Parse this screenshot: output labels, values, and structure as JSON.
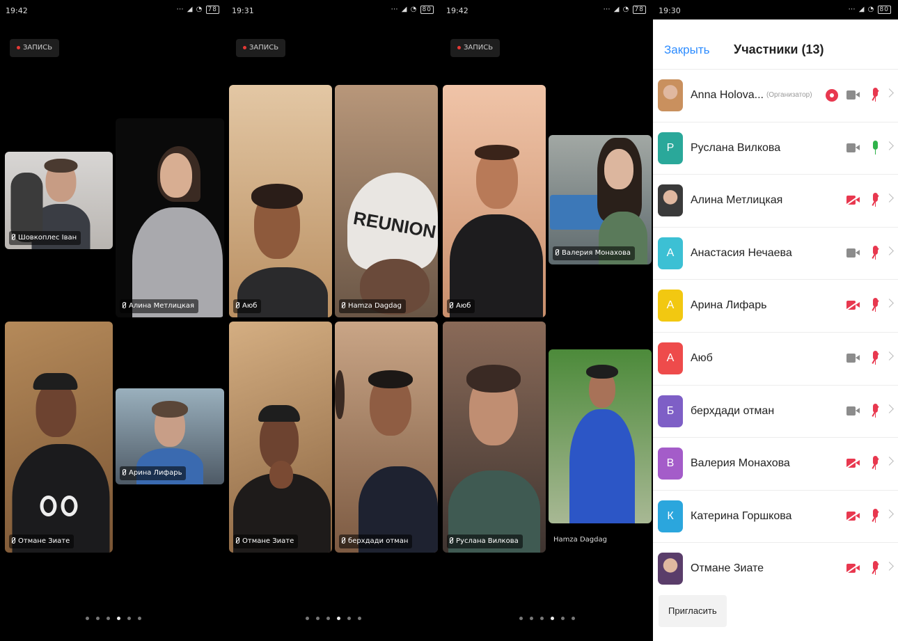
{
  "screens": [
    {
      "time": "19:42",
      "battery": "78",
      "record_label": "ЗАПИСЬ",
      "tiles": [
        {
          "name": "Шовкоплес Іван"
        },
        {
          "name": "Алина Метлицкая"
        },
        {
          "name": "Отмане Зиате"
        },
        {
          "name": "Арина Лифарь"
        }
      ],
      "page_count": 6,
      "active_page": 4
    },
    {
      "time": "19:31",
      "battery": "80",
      "record_label": "ЗАПИСЬ",
      "tiles": [
        {
          "name": "Аюб"
        },
        {
          "name": "Hamza Dagdag",
          "hat_text": "REUNION"
        },
        {
          "name": "Отмане Зиате"
        },
        {
          "name": "берхдади отман"
        }
      ],
      "page_count": 6,
      "active_page": 4
    },
    {
      "time": "19:42",
      "battery": "78",
      "record_label": "ЗАПИСЬ",
      "tiles": [
        {
          "name": "Аюб"
        },
        {
          "name": "Валерия Монахова"
        },
        {
          "name": "Руслана Вилкова"
        },
        {
          "name": "Hamza Dagdag"
        }
      ],
      "page_count": 6,
      "active_page": 4
    }
  ],
  "participants_panel": {
    "time": "19:30",
    "battery": "80",
    "close_label": "Закрыть",
    "title": "Участники (13)",
    "invite_label": "Пригласить",
    "participants": [
      {
        "name": "Anna Holova...",
        "role": "(Организатор)",
        "avatar": "",
        "color": "#c9905e",
        "photo": true,
        "recording": true,
        "video": "on",
        "audio": "muted"
      },
      {
        "name": "Руслана Вилкова",
        "avatar": "Р",
        "color": "#2aa89a",
        "video": "on",
        "audio": "live"
      },
      {
        "name": "Алина Метлицкая",
        "avatar": "",
        "color": "#3a3a3a",
        "photo": true,
        "video": "off",
        "audio": "muted"
      },
      {
        "name": "Анастасия Нечаева",
        "avatar": "А",
        "color": "#3cc0d4",
        "video": "on",
        "audio": "muted"
      },
      {
        "name": "Арина Лифарь",
        "avatar": "А",
        "color": "#f2c811",
        "video": "off",
        "audio": "muted"
      },
      {
        "name": "Аюб",
        "avatar": "А",
        "color": "#ee4b4b",
        "video": "on",
        "audio": "muted"
      },
      {
        "name": "берхдади отман",
        "avatar": "Б",
        "color": "#7e5fc6",
        "video": "on",
        "audio": "muted"
      },
      {
        "name": "Валерия Монахова",
        "avatar": "В",
        "color": "#a45cc9",
        "video": "off",
        "audio": "muted"
      },
      {
        "name": "Катерина Горшкова",
        "avatar": "К",
        "color": "#2ba6dd",
        "video": "off",
        "audio": "muted"
      },
      {
        "name": "Отмане Зиате",
        "avatar": "",
        "color": "#5a3d6a",
        "photo": true,
        "video": "off",
        "audio": "muted"
      }
    ]
  }
}
